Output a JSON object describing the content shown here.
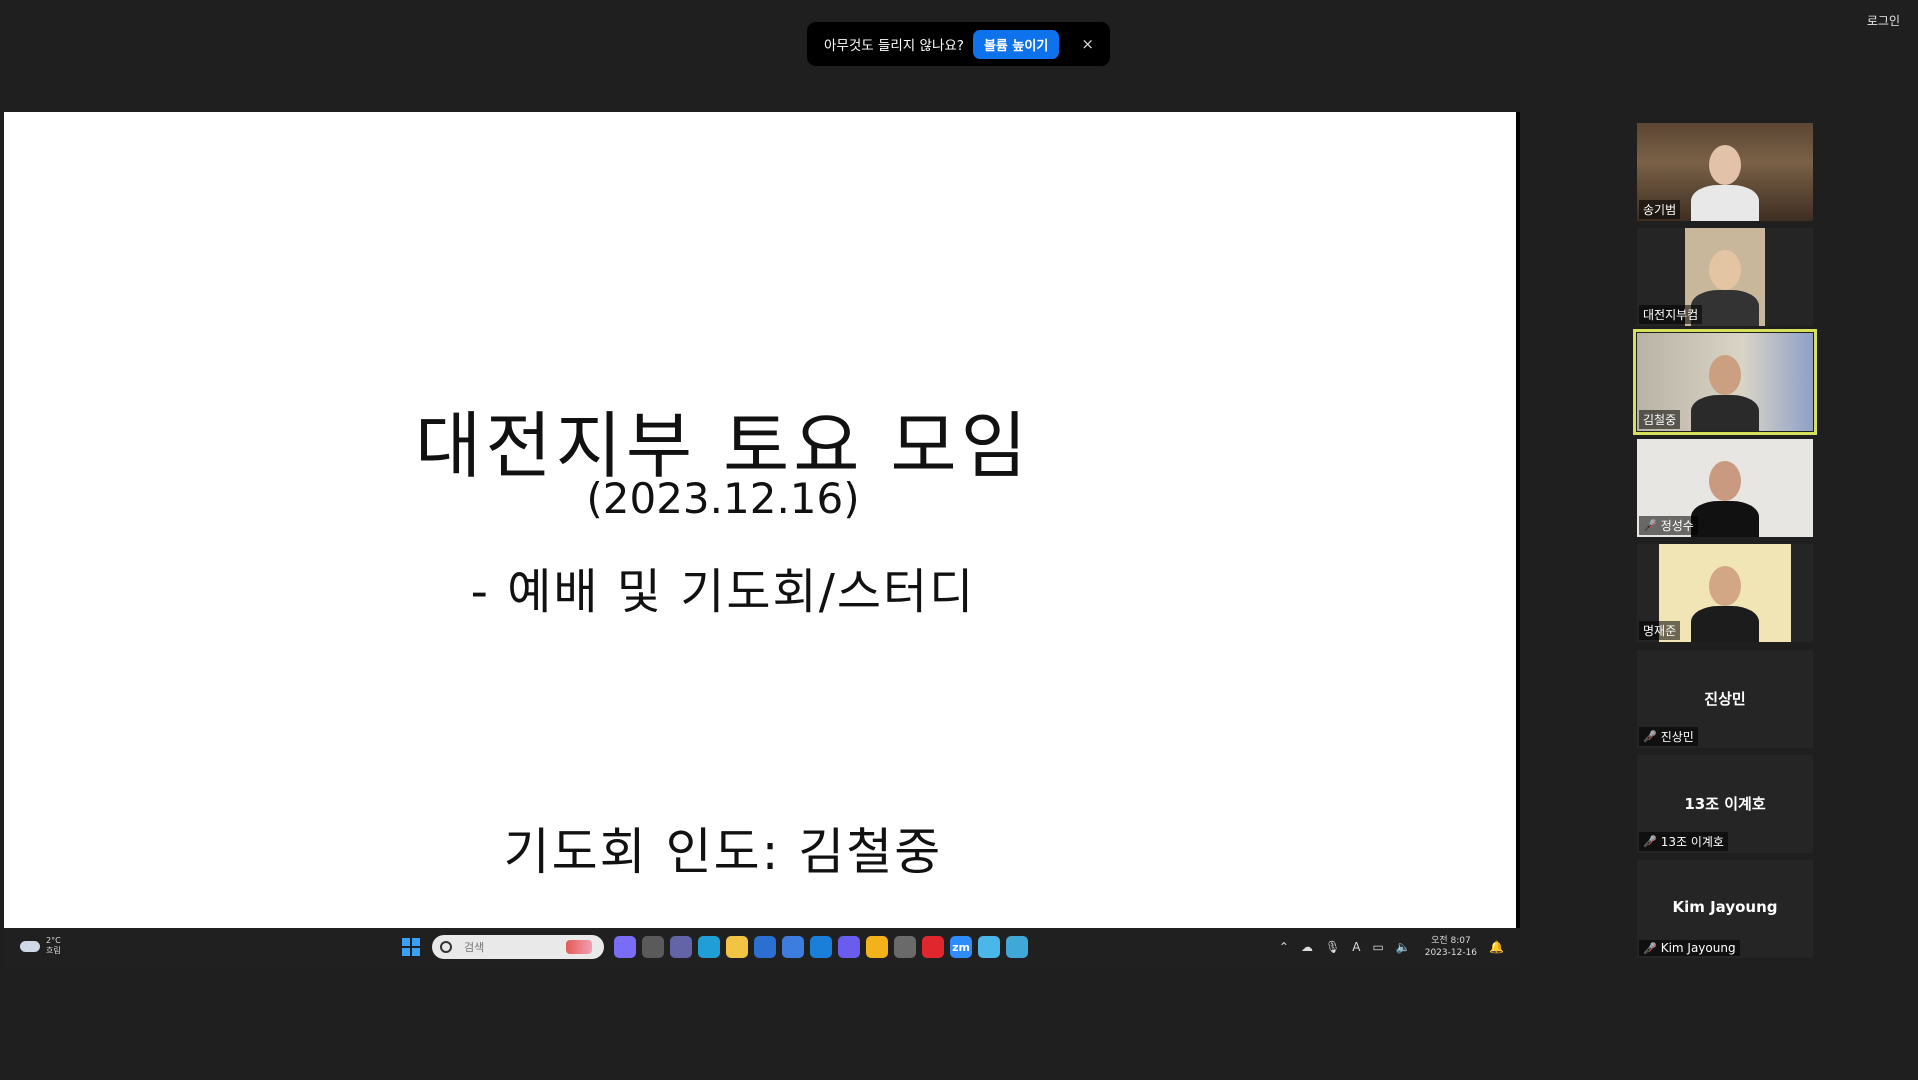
{
  "window": {
    "login_label": "로그인"
  },
  "notification": {
    "message": "아무것도 들리지 않나요?",
    "button": "볼륨 높이기",
    "close": "×"
  },
  "slide": {
    "title": "대전지부 토요 모임",
    "date": "(2023.12.16)",
    "subtitle": "- 예배 및 기도회/스터디",
    "leader": "기도회 인도: 김철중"
  },
  "taskbar": {
    "weather_temp": "2°C",
    "weather_desc": "흐림",
    "search_placeholder": "검색",
    "clock_ampm_time": "오전 8:07",
    "clock_date": "2023-12-16",
    "apps": [
      {
        "name": "copilot-icon",
        "color": "#7b6cf6"
      },
      {
        "name": "task-view-icon",
        "color": "#5a5a5a"
      },
      {
        "name": "teams-icon",
        "color": "#6264a7"
      },
      {
        "name": "edge-icon",
        "color": "#1f9fd6"
      },
      {
        "name": "file-explorer-icon",
        "color": "#f2c443"
      },
      {
        "name": "photo-app-icon",
        "color": "#2a6fd1"
      },
      {
        "name": "store-icon",
        "color": "#3d7de0"
      },
      {
        "name": "mail-icon",
        "color": "#1a7fd8"
      },
      {
        "name": "media-player-icon",
        "color": "#6b5cf0"
      },
      {
        "name": "chrome-icon",
        "color": "#f3b21b"
      },
      {
        "name": "camera-icon",
        "color": "#6a6a6a"
      },
      {
        "name": "opera-icon",
        "color": "#e1262d"
      },
      {
        "name": "zoom-icon",
        "color": "#2d8cff",
        "label": "zm"
      },
      {
        "name": "paint-icon",
        "color": "#4bb6e8"
      },
      {
        "name": "paint-icon-2",
        "color": "#3fa8d8"
      }
    ],
    "tray_icons": [
      "chevron-up-icon",
      "onedrive-icon",
      "mic-icon",
      "ime-icon",
      "network-icon",
      "speaker-icon",
      "notification-bell-icon"
    ],
    "ime_label": "A"
  },
  "participants": [
    {
      "name": "송기범",
      "video": true,
      "muted": false
    },
    {
      "name": "대전지부컴",
      "video": true,
      "muted": false
    },
    {
      "name": "김철중",
      "video": true,
      "muted": false,
      "active": true
    },
    {
      "name": "정성수",
      "video": true,
      "muted": true
    },
    {
      "name": "명재준",
      "video": true,
      "muted": false
    },
    {
      "name": "진상민",
      "video": false,
      "muted": true
    },
    {
      "name": "13조 이계호",
      "video": false,
      "muted": true
    },
    {
      "name": "Kim Jayoung",
      "video": false,
      "muted": true
    }
  ],
  "colors": {
    "accent_blue": "#0e72ed",
    "active_speaker": "#d6e05a",
    "muted_red": "#e04646"
  }
}
